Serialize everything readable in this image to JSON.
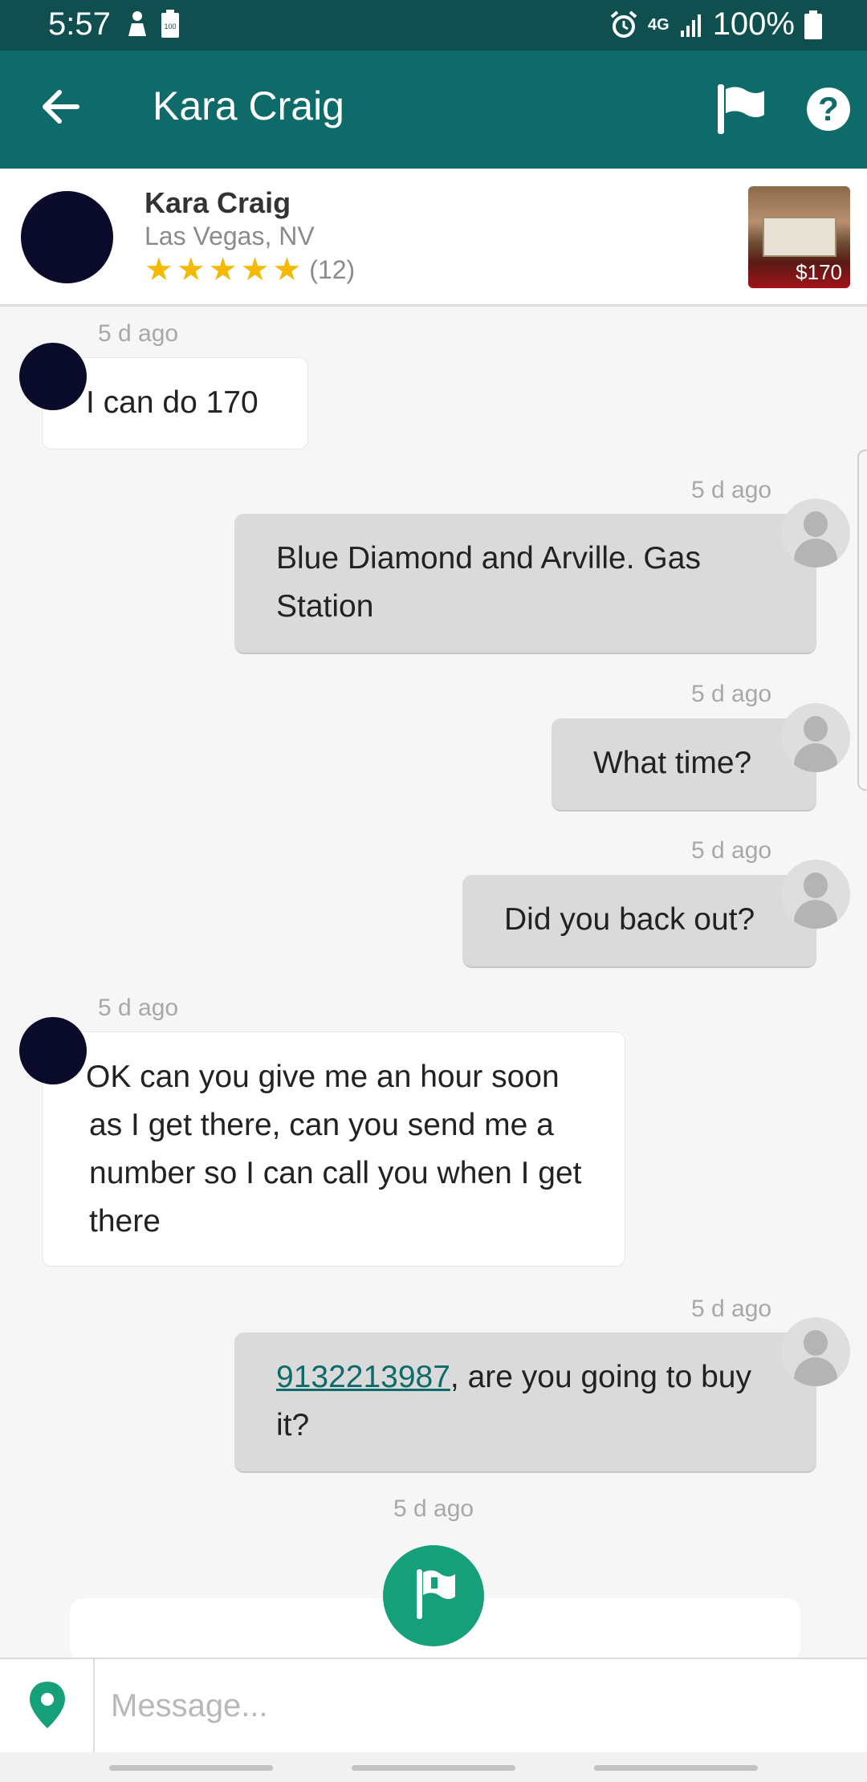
{
  "status_bar": {
    "time": "5:57",
    "network": "4G",
    "battery": "100%",
    "battery_small_label": "100"
  },
  "app_bar": {
    "title": "Kara Craig",
    "back_icon": "back-arrow-icon",
    "flag_icon": "flag-icon",
    "help_label": "?"
  },
  "seller": {
    "name": "Kara Craig",
    "location": "Las Vegas, NV",
    "stars": 5,
    "rating_count": "(12)",
    "item_price": "$170"
  },
  "messages": [
    {
      "direction": "in",
      "time": "5 d ago",
      "text": "I can do 170"
    },
    {
      "direction": "out",
      "time": "5 d ago",
      "text": "Blue Diamond and Arville. Gas Station"
    },
    {
      "direction": "out",
      "time": "5 d ago",
      "text": "What time?"
    },
    {
      "direction": "out",
      "time": "5 d ago",
      "text": "Did you back out?"
    },
    {
      "direction": "in",
      "time": "5 d ago",
      "text": "OK can you give me an hour soon as I get there, can you send me a number so I can call you when I get there"
    },
    {
      "direction": "out",
      "time": "5 d ago",
      "link": "9132213987",
      "text": ", are you going to buy it?"
    },
    {
      "direction": "system",
      "time": "5 d ago"
    }
  ],
  "composer": {
    "placeholder": "Message...",
    "location_icon": "map-pin-icon"
  },
  "colors": {
    "status_bar": "#104f50",
    "app_bar": "#0e6b6a",
    "accent_green": "#16a07a",
    "star": "#f5b900",
    "outgoing_bubble": "#dadada",
    "incoming_bubble": "#ffffff"
  }
}
